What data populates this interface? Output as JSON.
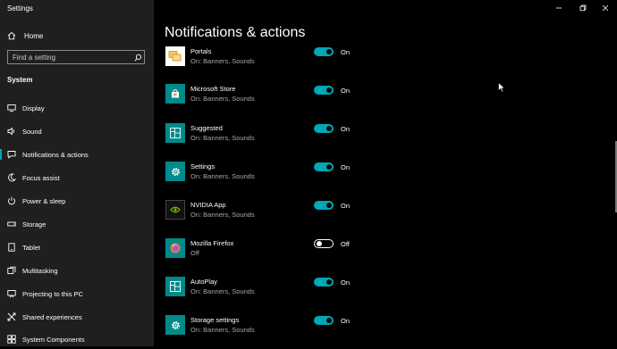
{
  "window": {
    "title": "Settings"
  },
  "sidebar": {
    "home_label": "Home",
    "search_placeholder": "Find a setting",
    "section_label": "System",
    "items": [
      {
        "label": "Display",
        "icon": "display-icon"
      },
      {
        "label": "Sound",
        "icon": "speaker-icon"
      },
      {
        "label": "Notifications & actions",
        "icon": "notification-icon",
        "active": true
      },
      {
        "label": "Focus assist",
        "icon": "moon-icon"
      },
      {
        "label": "Power & sleep",
        "icon": "power-icon"
      },
      {
        "label": "Storage",
        "icon": "storage-icon"
      },
      {
        "label": "Tablet",
        "icon": "tablet-icon"
      },
      {
        "label": "Multitasking",
        "icon": "multitasking-icon"
      },
      {
        "label": "Projecting to this PC",
        "icon": "projecting-icon"
      },
      {
        "label": "Shared experiences",
        "icon": "shared-experiences-icon"
      },
      {
        "label": "System Components",
        "icon": "components-icon"
      }
    ]
  },
  "main": {
    "title": "Notifications & actions",
    "apps": [
      {
        "name": "Portals",
        "status": "On: Banners, Sounds",
        "toggle": "On",
        "icon": "portals-icon"
      },
      {
        "name": "Microsoft Store",
        "status": "On: Banners, Sounds",
        "toggle": "On",
        "icon": "store-icon"
      },
      {
        "name": "Suggested",
        "status": "On: Banners, Sounds",
        "toggle": "On",
        "icon": "tiles-icon"
      },
      {
        "name": "Settings",
        "status": "On: Banners, Sounds",
        "toggle": "On",
        "icon": "gear-icon"
      },
      {
        "name": "NVIDIA App",
        "status": "On: Banners, Sounds",
        "toggle": "On",
        "icon": "nvidia-icon"
      },
      {
        "name": "Mozilla Firefox",
        "status": "Off",
        "toggle": "Off",
        "icon": "firefox-icon"
      },
      {
        "name": "AutoPlay",
        "status": "On: Banners, Sounds",
        "toggle": "On",
        "icon": "tiles-icon"
      },
      {
        "name": "Storage settings",
        "status": "On: Banners, Sounds",
        "toggle": "On",
        "icon": "gear-icon"
      }
    ]
  },
  "colors": {
    "accent": "#00a8b5",
    "tile": "#008a8a",
    "sidebar_bg": "#1f1f1f",
    "main_bg": "#000000"
  }
}
